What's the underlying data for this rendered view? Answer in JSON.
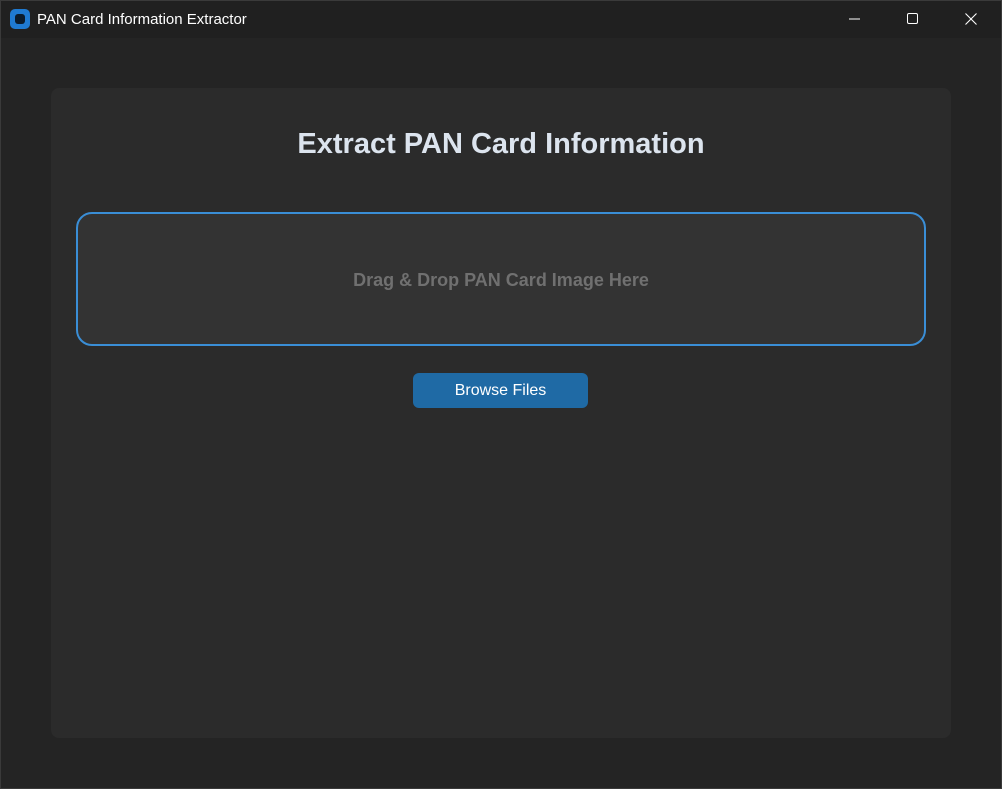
{
  "window": {
    "title": "PAN Card Information Extractor",
    "icon": "app-icon",
    "controls": [
      "minimize-icon",
      "maximize-icon",
      "close-icon"
    ]
  },
  "main": {
    "heading": "Extract PAN Card Information",
    "dropzone_label": "Drag & Drop PAN Card Image Here",
    "browse_label": "Browse Files"
  },
  "colors": {
    "accent": "#1f6aa5",
    "dropzone_border": "#3a8ed6",
    "background": "#242424",
    "panel": "#2b2b2b"
  }
}
